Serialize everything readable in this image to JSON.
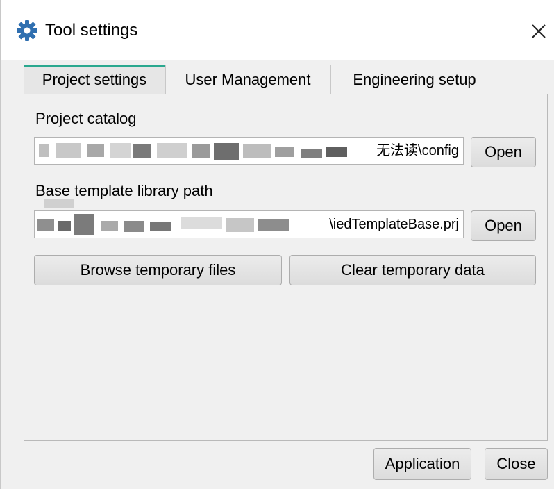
{
  "window": {
    "title": "Tool settings",
    "icon": "gear-icon",
    "close_icon": "close-icon"
  },
  "tabs": [
    {
      "label": "Project settings",
      "active": true
    },
    {
      "label": "User Management",
      "active": false
    },
    {
      "label": "Engineering setup",
      "active": false
    }
  ],
  "project_catalog": {
    "label": "Project catalog",
    "value_visible_tail": "无法读\\config",
    "open_label": "Open"
  },
  "base_template": {
    "label": "Base template library path",
    "value_visible_tail": "\\iedTemplateBase.prj",
    "open_label": "Open"
  },
  "actions": {
    "browse_label": "Browse temporary files",
    "clear_label": "Clear temporary data"
  },
  "footer": {
    "apply_label": "Application",
    "close_label": "Close"
  },
  "colors": {
    "accent_tab": "#2aa88f",
    "icon_blue": "#2f6fb0"
  }
}
